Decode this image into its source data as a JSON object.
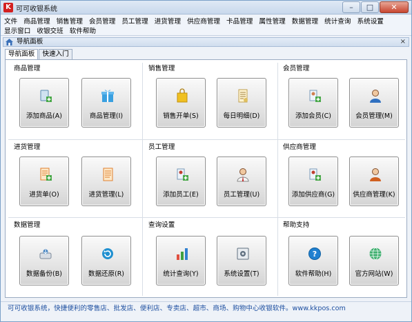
{
  "window": {
    "title": "可可收银系统",
    "icon": "K"
  },
  "window_controls": {
    "minimize": "–",
    "maximize": "□",
    "close": "✕"
  },
  "menu_row1": [
    "文件",
    "商品管理",
    "销售管理",
    "会员管理",
    "员工管理",
    "进货管理",
    "供应商管理",
    "卡品管理",
    "属性管理",
    "数据管理",
    "统计查询",
    "系统设置"
  ],
  "menu_row2": [
    "显示窗口",
    "收银交班",
    "软件帮助"
  ],
  "panel": {
    "title": "导航面板",
    "close": "×"
  },
  "tabs": [
    "导航面板",
    "快速入门"
  ],
  "groups": {
    "g1": "商品管理",
    "g2": "销售管理",
    "g3": "会员管理",
    "g4": "进货管理",
    "g5": "员工管理",
    "g6": "供应商管理",
    "g7": "数据管理",
    "g8": "查询设置",
    "g9": "帮助支持"
  },
  "tiles": [
    {
      "label": "添加商品(A)",
      "icon": "add-product-icon",
      "color": "#5aa0d0"
    },
    {
      "label": "商品管理(I)",
      "icon": "gift-box-icon",
      "color": "#3aa0e0"
    },
    {
      "label": "销售开单(S)",
      "icon": "shopping-bag-icon",
      "color": "#f0c020"
    },
    {
      "label": "每日明细(D)",
      "icon": "receipt-icon",
      "color": "#e0c060"
    },
    {
      "label": "添加会员(C)",
      "icon": "add-member-icon",
      "color": "#50a050"
    },
    {
      "label": "会员管理(M)",
      "icon": "member-icon",
      "color": "#3070c0"
    },
    {
      "label": "进货单(O)",
      "icon": "purchase-order-icon",
      "color": "#f08030"
    },
    {
      "label": "进货管理(L)",
      "icon": "purchase-list-icon",
      "color": "#f08030"
    },
    {
      "label": "添加员工(E)",
      "icon": "add-employee-icon",
      "color": "#50a050"
    },
    {
      "label": "员工管理(U)",
      "icon": "employee-icon",
      "color": "#c03030"
    },
    {
      "label": "添加供应商(G)",
      "icon": "add-supplier-icon",
      "color": "#50a050"
    },
    {
      "label": "供应商管理(K)",
      "icon": "supplier-icon",
      "color": "#d06020"
    },
    {
      "label": "数据备份(B)",
      "icon": "backup-icon",
      "color": "#4080c0"
    },
    {
      "label": "数据还原(R)",
      "icon": "restore-icon",
      "color": "#2090d0"
    },
    {
      "label": "统计查询(Y)",
      "icon": "statistics-icon",
      "color": "#40a040"
    },
    {
      "label": "系统设置(T)",
      "icon": "settings-icon",
      "color": "#607080"
    },
    {
      "label": "软件帮助(H)",
      "icon": "help-icon",
      "color": "#2080d0"
    },
    {
      "label": "官方网站(W)",
      "icon": "website-icon",
      "color": "#30a060"
    }
  ],
  "status": "可可收银系统，快捷便利的零售店、批发店、便利店、专卖店、超市、商场、购物中心收银软件。www.kkpos.com",
  "colors": {
    "accent": "#1d4fa0",
    "title_gradient": "#c8d8ec",
    "close_red": "#c8452f"
  }
}
